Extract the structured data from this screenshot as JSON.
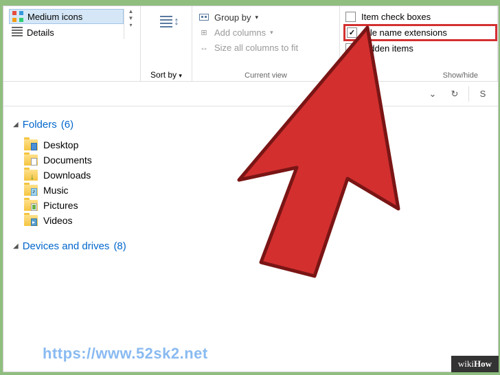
{
  "ribbon": {
    "layout": {
      "medium_icons": "Medium icons",
      "details": "Details"
    },
    "sort": {
      "label": "Sort by"
    },
    "current_view": {
      "group_by": "Group by",
      "add_columns": "Add columns",
      "size_all": "Size all columns to fit",
      "group_label": "Current view"
    },
    "show_hide": {
      "item_checkboxes": "Item check boxes",
      "file_name_extensions": "File name extensions",
      "hidden_items": "Hidden items",
      "group_label": "Show/hide",
      "item_checkboxes_checked": false,
      "file_name_extensions_checked": true,
      "hidden_items_checked": true
    }
  },
  "sections": {
    "folders": {
      "title": "Folders",
      "count": "(6)"
    },
    "devices": {
      "title": "Devices and drives",
      "count": "(8)"
    }
  },
  "folders": [
    {
      "name": "Desktop"
    },
    {
      "name": "Documents"
    },
    {
      "name": "Downloads"
    },
    {
      "name": "Music"
    },
    {
      "name": "Pictures"
    },
    {
      "name": "Videos"
    }
  ],
  "watermark": {
    "url": "https://www.52sk2.net",
    "brand_prefix": "wiki",
    "brand_suffix": "How"
  }
}
